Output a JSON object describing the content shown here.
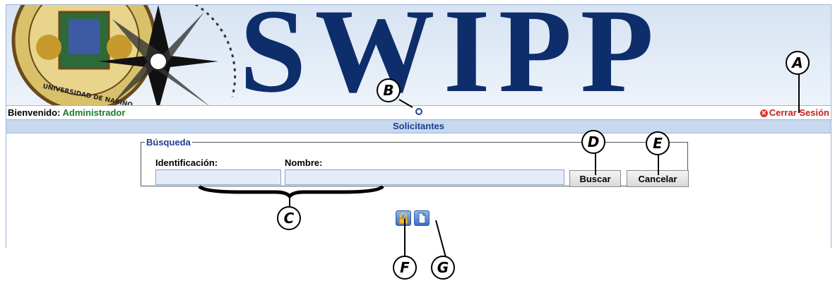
{
  "banner": {
    "title": "SWIPP",
    "seal_text": "UNIVERSIDAD DE NARIÑO"
  },
  "header": {
    "welcome_label": "Bienvenido:",
    "user_name": "Administrador",
    "logout_label": "Cerrar Sesión"
  },
  "section": {
    "title": "Solicitantes"
  },
  "search": {
    "legend": "Búsqueda",
    "id_label": "Identificación:",
    "id_value": "",
    "name_label": "Nombre:",
    "name_value": "",
    "search_button": "Buscar",
    "cancel_button": "Cancelar"
  },
  "actions": [
    {
      "icon": "lock-icon"
    },
    {
      "icon": "document-icon"
    }
  ],
  "callouts": {
    "a": "A",
    "b": "B",
    "c": "C",
    "d": "D",
    "e": "E",
    "f": "F",
    "g": "G"
  },
  "colors": {
    "accent": "#1d3f8f",
    "banner_text": "#0d2e6b",
    "user_name": "#1b7b2c",
    "logout": "#c62020",
    "section_bar": "#c7d8ef"
  }
}
